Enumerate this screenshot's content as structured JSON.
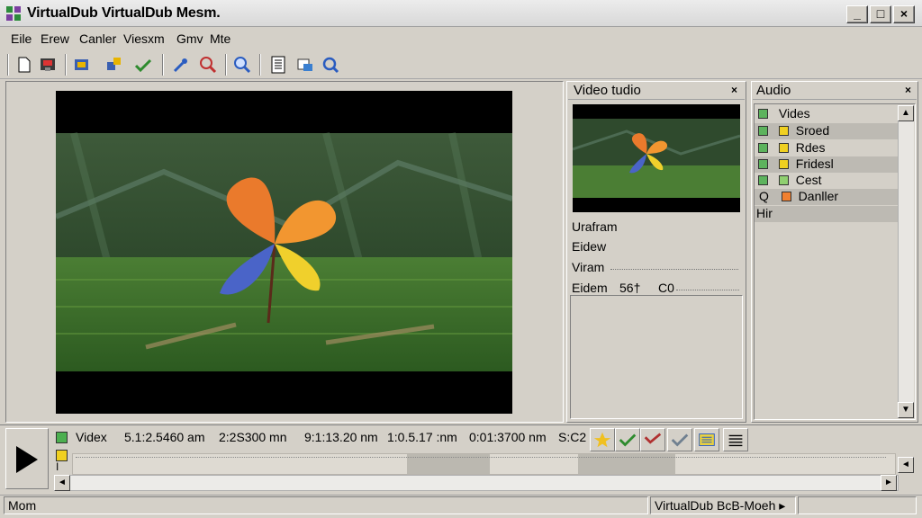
{
  "window": {
    "title": "VirtualDub  VirtualDub Mesm.",
    "minimize_glyph": "_",
    "maximize_glyph": "□",
    "close_glyph": "×"
  },
  "menu": [
    "Eile",
    "Erew",
    "Canler",
    "Viesxm",
    "Gmv",
    "Mte"
  ],
  "toolbar": {
    "icons": [
      "new-file-icon",
      "save-icon",
      "open-icon",
      "export-icon",
      "check-icon",
      "pipette-icon",
      "zoom-out-icon",
      "zoom-in-icon",
      "film-icon",
      "frame-icon",
      "refresh-icon"
    ]
  },
  "video_info_panel": {
    "title": "Video tudio",
    "close": "×",
    "lines": {
      "line1": "Urafram",
      "line2": "Eidew",
      "line3": "Viram",
      "line4_label": "Eidem",
      "line4_value1": "56†",
      "line4_value2": "C0"
    }
  },
  "audio_panel": {
    "title": "Audio",
    "close": "×",
    "items": [
      {
        "label": "Vides",
        "color": "#5db35d"
      },
      {
        "label": "Sroed",
        "color": "#f0d020"
      },
      {
        "label": "Rdes",
        "color": "#f0d020"
      },
      {
        "label": "Fridesl",
        "color": "#f0d020"
      },
      {
        "label": "Cest",
        "color": "#90d070"
      },
      {
        "label": "Danller",
        "color": "#f08030"
      },
      {
        "label": "Hir",
        "color": ""
      }
    ],
    "scroll_up": "▲",
    "scroll_down": "▼"
  },
  "timeline": {
    "track_label": "Videx",
    "times": [
      "5.1:2.5460 am",
      "2:2S300 mn",
      "9:1:13.20 nm",
      "1:0.5.17 :nm",
      "0:01:3700 nm",
      "S:C2"
    ],
    "scroll_left": "◄",
    "scroll_right": "►"
  },
  "statusbar": {
    "left": "Mom",
    "right": "VirtualDub BcB-Moeh ▸"
  },
  "colors": {
    "chrome": "#d4d0c8",
    "title_gradient_top": "#ececec",
    "video_bg": "#000000"
  }
}
